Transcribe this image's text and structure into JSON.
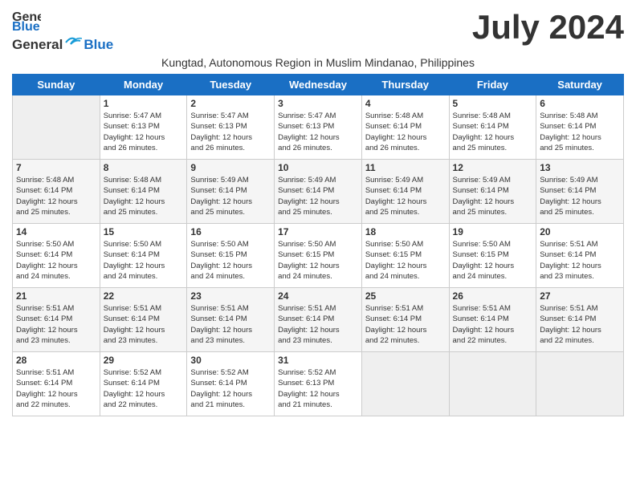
{
  "header": {
    "logo_line1": "General",
    "logo_line2": "Blue",
    "month_title": "July 2024",
    "subtitle": "Kungtad, Autonomous Region in Muslim Mindanao, Philippines"
  },
  "weekdays": [
    "Sunday",
    "Monday",
    "Tuesday",
    "Wednesday",
    "Thursday",
    "Friday",
    "Saturday"
  ],
  "weeks": [
    [
      {
        "day": "",
        "info": ""
      },
      {
        "day": "1",
        "info": "Sunrise: 5:47 AM\nSunset: 6:13 PM\nDaylight: 12 hours\nand 26 minutes."
      },
      {
        "day": "2",
        "info": "Sunrise: 5:47 AM\nSunset: 6:13 PM\nDaylight: 12 hours\nand 26 minutes."
      },
      {
        "day": "3",
        "info": "Sunrise: 5:47 AM\nSunset: 6:13 PM\nDaylight: 12 hours\nand 26 minutes."
      },
      {
        "day": "4",
        "info": "Sunrise: 5:48 AM\nSunset: 6:14 PM\nDaylight: 12 hours\nand 26 minutes."
      },
      {
        "day": "5",
        "info": "Sunrise: 5:48 AM\nSunset: 6:14 PM\nDaylight: 12 hours\nand 25 minutes."
      },
      {
        "day": "6",
        "info": "Sunrise: 5:48 AM\nSunset: 6:14 PM\nDaylight: 12 hours\nand 25 minutes."
      }
    ],
    [
      {
        "day": "7",
        "info": "Sunrise: 5:48 AM\nSunset: 6:14 PM\nDaylight: 12 hours\nand 25 minutes."
      },
      {
        "day": "8",
        "info": "Sunrise: 5:48 AM\nSunset: 6:14 PM\nDaylight: 12 hours\nand 25 minutes."
      },
      {
        "day": "9",
        "info": "Sunrise: 5:49 AM\nSunset: 6:14 PM\nDaylight: 12 hours\nand 25 minutes."
      },
      {
        "day": "10",
        "info": "Sunrise: 5:49 AM\nSunset: 6:14 PM\nDaylight: 12 hours\nand 25 minutes."
      },
      {
        "day": "11",
        "info": "Sunrise: 5:49 AM\nSunset: 6:14 PM\nDaylight: 12 hours\nand 25 minutes."
      },
      {
        "day": "12",
        "info": "Sunrise: 5:49 AM\nSunset: 6:14 PM\nDaylight: 12 hours\nand 25 minutes."
      },
      {
        "day": "13",
        "info": "Sunrise: 5:49 AM\nSunset: 6:14 PM\nDaylight: 12 hours\nand 25 minutes."
      }
    ],
    [
      {
        "day": "14",
        "info": "Sunrise: 5:50 AM\nSunset: 6:14 PM\nDaylight: 12 hours\nand 24 minutes."
      },
      {
        "day": "15",
        "info": "Sunrise: 5:50 AM\nSunset: 6:14 PM\nDaylight: 12 hours\nand 24 minutes."
      },
      {
        "day": "16",
        "info": "Sunrise: 5:50 AM\nSunset: 6:15 PM\nDaylight: 12 hours\nand 24 minutes."
      },
      {
        "day": "17",
        "info": "Sunrise: 5:50 AM\nSunset: 6:15 PM\nDaylight: 12 hours\nand 24 minutes."
      },
      {
        "day": "18",
        "info": "Sunrise: 5:50 AM\nSunset: 6:15 PM\nDaylight: 12 hours\nand 24 minutes."
      },
      {
        "day": "19",
        "info": "Sunrise: 5:50 AM\nSunset: 6:15 PM\nDaylight: 12 hours\nand 24 minutes."
      },
      {
        "day": "20",
        "info": "Sunrise: 5:51 AM\nSunset: 6:14 PM\nDaylight: 12 hours\nand 23 minutes."
      }
    ],
    [
      {
        "day": "21",
        "info": "Sunrise: 5:51 AM\nSunset: 6:14 PM\nDaylight: 12 hours\nand 23 minutes."
      },
      {
        "day": "22",
        "info": "Sunrise: 5:51 AM\nSunset: 6:14 PM\nDaylight: 12 hours\nand 23 minutes."
      },
      {
        "day": "23",
        "info": "Sunrise: 5:51 AM\nSunset: 6:14 PM\nDaylight: 12 hours\nand 23 minutes."
      },
      {
        "day": "24",
        "info": "Sunrise: 5:51 AM\nSunset: 6:14 PM\nDaylight: 12 hours\nand 23 minutes."
      },
      {
        "day": "25",
        "info": "Sunrise: 5:51 AM\nSunset: 6:14 PM\nDaylight: 12 hours\nand 22 minutes."
      },
      {
        "day": "26",
        "info": "Sunrise: 5:51 AM\nSunset: 6:14 PM\nDaylight: 12 hours\nand 22 minutes."
      },
      {
        "day": "27",
        "info": "Sunrise: 5:51 AM\nSunset: 6:14 PM\nDaylight: 12 hours\nand 22 minutes."
      }
    ],
    [
      {
        "day": "28",
        "info": "Sunrise: 5:51 AM\nSunset: 6:14 PM\nDaylight: 12 hours\nand 22 minutes."
      },
      {
        "day": "29",
        "info": "Sunrise: 5:52 AM\nSunset: 6:14 PM\nDaylight: 12 hours\nand 22 minutes."
      },
      {
        "day": "30",
        "info": "Sunrise: 5:52 AM\nSunset: 6:14 PM\nDaylight: 12 hours\nand 21 minutes."
      },
      {
        "day": "31",
        "info": "Sunrise: 5:52 AM\nSunset: 6:13 PM\nDaylight: 12 hours\nand 21 minutes."
      },
      {
        "day": "",
        "info": ""
      },
      {
        "day": "",
        "info": ""
      },
      {
        "day": "",
        "info": ""
      }
    ]
  ]
}
